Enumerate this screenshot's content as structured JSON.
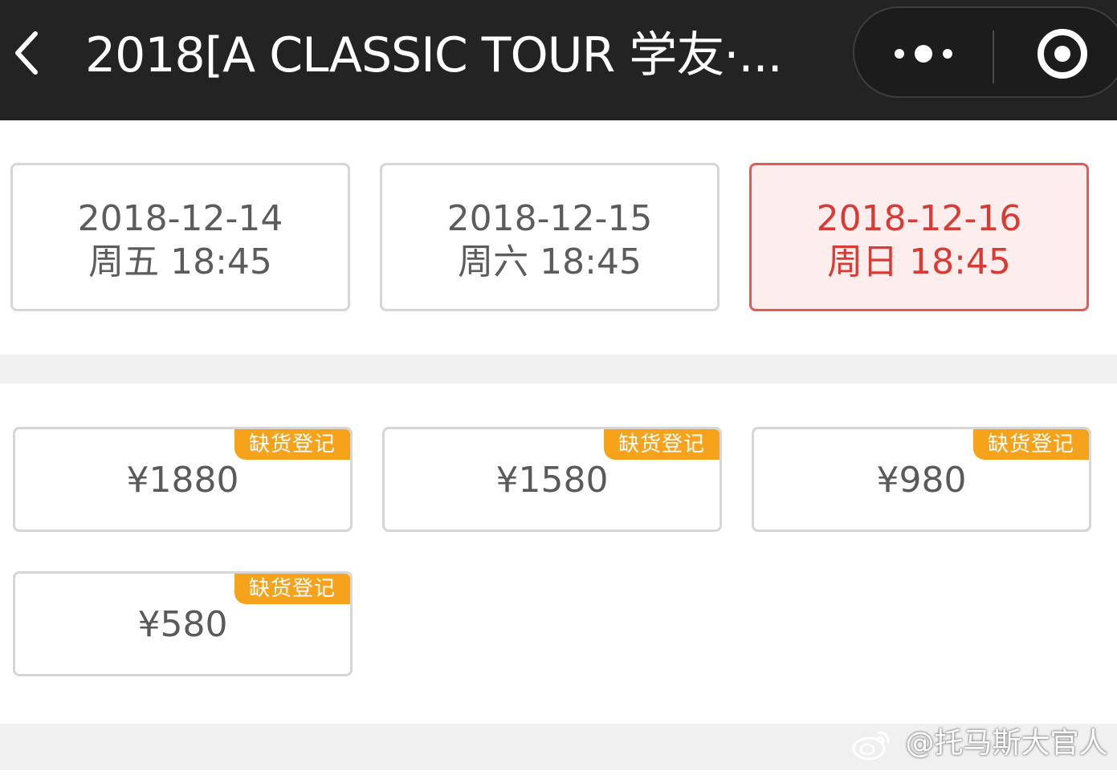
{
  "header": {
    "title": "2018[A CLASSIC TOUR 学友·...",
    "back_icon": "chevron-left-icon",
    "more_icon": "more-dots-icon",
    "close_icon": "target-circle-icon",
    "background": "#232323"
  },
  "dates": [
    {
      "date": "2018-12-14",
      "time": "周五 18:45",
      "selected": false
    },
    {
      "date": "2018-12-15",
      "time": "周六 18:45",
      "selected": false
    },
    {
      "date": "2018-12-16",
      "time": "周日 18:45",
      "selected": true
    }
  ],
  "prices": [
    {
      "price": "¥1880",
      "badge": "缺货登记"
    },
    {
      "price": "¥1580",
      "badge": "缺货登记"
    },
    {
      "price": "¥980",
      "badge": "缺货登记"
    },
    {
      "price": "¥580",
      "badge": "缺货登记"
    }
  ],
  "watermark": {
    "logo_icon": "weibo-logo-icon",
    "text": "@托马斯大官人"
  },
  "colors": {
    "selected_border": "#e25a52",
    "selected_text": "#d93a33",
    "selected_bg": "#fdeeed",
    "badge_bg": "#f7a21b"
  }
}
